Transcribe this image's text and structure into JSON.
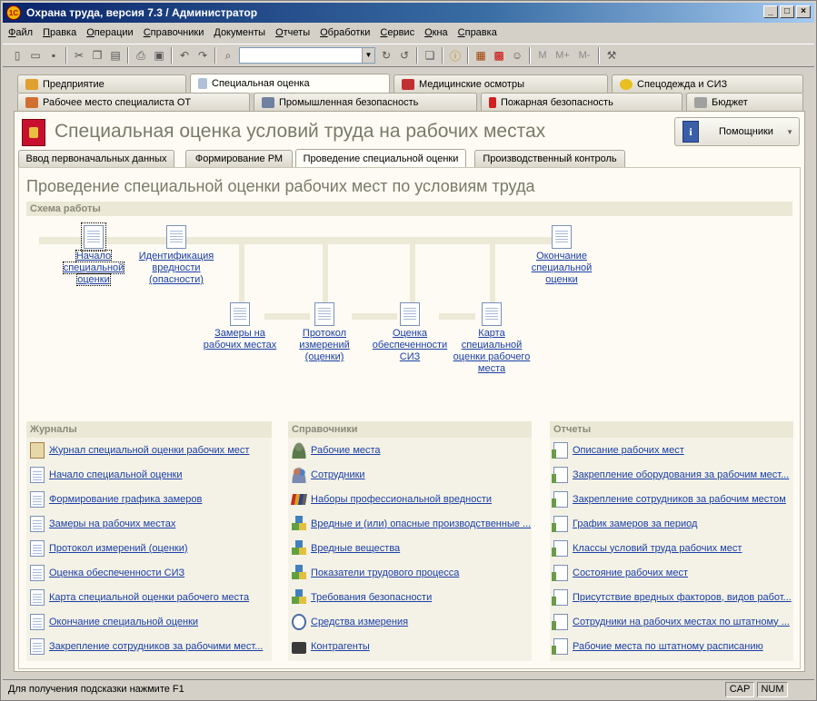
{
  "window": {
    "title": "Охрана труда, версия 7.3 / Администратор",
    "logo": "1С"
  },
  "menu": [
    "Файл",
    "Правка",
    "Операции",
    "Справочники",
    "Документы",
    "Отчеты",
    "Обработки",
    "Сервис",
    "Окна",
    "Справка"
  ],
  "toolbar": {
    "m": "M",
    "mplus": "M+",
    "mminus": "M-"
  },
  "tabs_row1": [
    "Предприятие",
    "Специальная оценка",
    "Медицинские осмотры",
    "Спецодежда и СИЗ"
  ],
  "tabs_row2": [
    "Рабочее место специалиста ОТ",
    "Промышленная безопасность",
    "Пожарная безопасность",
    "Бюджет"
  ],
  "page": {
    "title": "Специальная оценка условий труда на рабочих местах",
    "helper": "Помощники"
  },
  "subtabs": [
    "Ввод первоначальных данных",
    "Формирование РМ",
    "Проведение специальной оценки",
    "Производственный контроль"
  ],
  "section": {
    "title": "Проведение специальной оценки рабочих мест по условиям труда",
    "schema_header": "Схема работы"
  },
  "schema": {
    "n1": [
      "Начало",
      "специальной",
      "оценки"
    ],
    "n2": [
      "Идентификация",
      "вредности",
      "(опасности)"
    ],
    "n3": [
      "Окончание",
      "специальной",
      "оценки"
    ],
    "n4": [
      "Замеры на",
      "рабочих местах"
    ],
    "n5": [
      "Протокол",
      "измерений",
      "(оценки)"
    ],
    "n6": [
      "Оценка",
      "обеспеченности",
      "СИЗ"
    ],
    "n7": [
      "Карта",
      "специальной",
      "оценки рабочего",
      "места"
    ]
  },
  "journals": {
    "header": "Журналы",
    "items": [
      "Журнал специальной оценки рабочих мест",
      "Начало специальной оценки",
      "Формирование графика замеров",
      "Замеры на рабочих местах",
      "Протокол измерений (оценки)",
      "Оценка обеспеченности СИЗ",
      "Карта специальной оценки рабочего места",
      "Окончание специальной оценки",
      "Закрепление сотрудников за рабочими мест..."
    ]
  },
  "references": {
    "header": "Справочники",
    "items": [
      "Рабочие места",
      "Сотрудники",
      "Наборы профессиональной вредности",
      "Вредные и (или) опасные производственные ...",
      "Вредные вещества",
      "Показатели трудового процесса",
      "Требования безопасности",
      "Средства измерения",
      "Контрагенты"
    ],
    "icons": [
      "person",
      "people",
      "books",
      "cubes",
      "cubes",
      "cubes",
      "cubes",
      "clock",
      "case"
    ]
  },
  "reports": {
    "header": "Отчеты",
    "items": [
      "Описание рабочих мест",
      "Закрепление оборудования за рабочим мест...",
      "Закрепление сотрудников за рабочим местом",
      "График замеров за период",
      "Классы условий труда рабочих мест",
      "Состояние рабочих мест",
      "Присутствие вредных факторов, видов работ...",
      "Сотрудники на рабочих местах по штатному ...",
      "Рабочие места по штатному расписанию"
    ]
  },
  "status": {
    "hint": "Для получения подсказки нажмите F1",
    "cap": "CAP",
    "num": "NUM"
  }
}
